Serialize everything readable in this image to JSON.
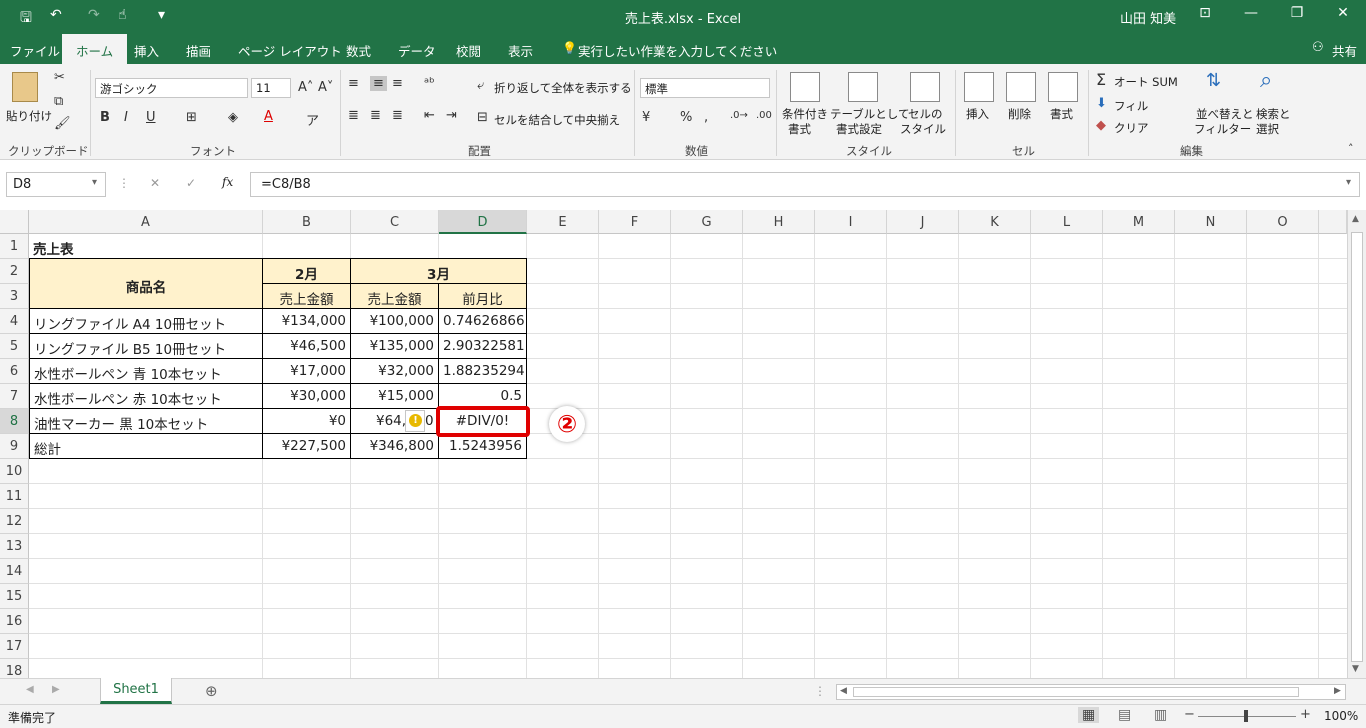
{
  "window": {
    "title": "売上表.xlsx  -  Excel",
    "user": "山田 知美",
    "quick_access": {
      "save": "🖫",
      "undo": "↶",
      "redo": "↷",
      "touch": "☝",
      "customize": "▾"
    },
    "controls": {
      "ribbon_opts": "⊡",
      "minimize": "—",
      "restore": "❐",
      "close": "✕"
    }
  },
  "tabs": [
    "ファイル",
    "ホーム",
    "挿入",
    "描画",
    "ページ レイアウト",
    "数式",
    "データ",
    "校閲",
    "表示"
  ],
  "active_tab": "ホーム",
  "tell_me": "実行したい作業を入力してください",
  "share": "共有",
  "ribbon": {
    "clipboard": {
      "label": "クリップボード",
      "paste": "貼り付け"
    },
    "font": {
      "label": "フォント",
      "name": "游ゴシック",
      "size": "11",
      "bold": "B",
      "italic": "I",
      "underline": "U"
    },
    "alignment": {
      "label": "配置",
      "wrap": "折り返して全体を表示する",
      "merge": "セルを結合して中央揃え"
    },
    "number": {
      "label": "数値",
      "format": "標準"
    },
    "styles": {
      "label": "スタイル",
      "conditional": [
        "条件付き",
        "書式"
      ],
      "table": [
        "テーブルとして",
        "書式設定"
      ],
      "cell": [
        "セルの",
        "スタイル"
      ]
    },
    "cells": {
      "label": "セル",
      "insert": "挿入",
      "delete": "削除",
      "format": "書式"
    },
    "editing": {
      "label": "編集",
      "autosum": "オート SUM",
      "fill": "フィル",
      "clear": "クリア",
      "sort": [
        "並べ替えと",
        "フィルター"
      ],
      "find": [
        "検索と",
        "選択"
      ]
    }
  },
  "formula_bar": {
    "name_box": "D8",
    "formula": "=C8/B8",
    "fx": "fx"
  },
  "columns": [
    "A",
    "B",
    "C",
    "D",
    "E",
    "F",
    "G",
    "H",
    "I",
    "J",
    "K",
    "L",
    "M",
    "N",
    "O"
  ],
  "selected_column": "D",
  "rows": [
    "1",
    "2",
    "3",
    "4",
    "5",
    "6",
    "7",
    "8",
    "9",
    "10",
    "11",
    "12",
    "13",
    "14",
    "15",
    "16",
    "17",
    "18"
  ],
  "selected_row": "8",
  "sheet": {
    "title": "売上表",
    "header_product": "商品名",
    "header_feb": "2月",
    "header_mar": "3月",
    "sub_feb": "売上金額",
    "sub_mar": "売上金額",
    "sub_ratio": "前月比",
    "data": [
      {
        "name": "リングファイル A4 10冊セット",
        "feb": "¥134,000",
        "mar": "¥100,000",
        "ratio": "0.74626866"
      },
      {
        "name": "リングファイル B5 10冊セット",
        "feb": "¥46,500",
        "mar": "¥135,000",
        "ratio": "2.90322581"
      },
      {
        "name": "水性ボールペン 青 10本セット",
        "feb": "¥17,000",
        "mar": "¥32,000",
        "ratio": "1.88235294"
      },
      {
        "name": "水性ボールペン 赤 10本セット",
        "feb": "¥30,000",
        "mar": "¥15,000",
        "ratio": "0.5"
      },
      {
        "name": "油性マーカー 黒 10本セット",
        "feb": "¥0",
        "mar": "¥64,",
        "mar_tail": "0",
        "ratio": "#DIV/0!"
      },
      {
        "name": "総計",
        "feb": "¥227,500",
        "mar": "¥346,800",
        "ratio": "1.5243956"
      }
    ]
  },
  "annotation": "②",
  "error_icon": "!",
  "sheet_tab": "Sheet1",
  "status": {
    "ready": "準備完了",
    "zoom": "100%"
  },
  "colors": {
    "excel_green": "#217346",
    "header_fill": "#fff2cc",
    "callout_red": "#e00000"
  }
}
